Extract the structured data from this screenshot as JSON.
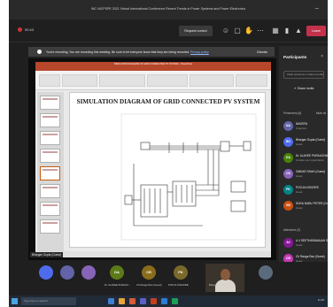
{
  "window": {
    "title": "INC NICPSPE 2021 Virtual International Conference Recent Trends in Power Systems and Power Electronics",
    "minimize_glyph": "−"
  },
  "toolbar": {
    "timer": "00:43",
    "request_control": "Request control",
    "leave": "Leave",
    "icons": [
      "people-icon",
      "chat-icon",
      "hand-icon",
      "more-icon",
      "camera-icon",
      "mic-icon",
      "share-icon"
    ]
  },
  "banner": {
    "message": "You're recording. You are recording this meeting. Be sure to let everyone know that they are being recorded.",
    "link": "Privacy policy",
    "dismiss": "Dismiss"
  },
  "presentation": {
    "app_title": "SIMULATION DIAGRAM OF GRID CONNECTED PV SYSTEM - PowerPoint",
    "slide_title": "SIMULATION DIAGRAM OF GRID CONNECTED PV SYSTEM",
    "presenter": "Bhargav Gupta (Guest)"
  },
  "participants": {
    "header": "Participants",
    "invite_placeholder": "Invite someone or dial a number",
    "share_invite": "Share invite",
    "presenters_section": "Presenters (8)",
    "mute_all": "Mute all",
    "presenters": [
      {
        "initials": "NA",
        "name": "NAVEEN",
        "role": "Organizer",
        "color": "#6264a7"
      },
      {
        "initials": "BG",
        "name": "Bhargav Gupta (Guest)",
        "role": "Guest",
        "color": "#4f6bed"
      },
      {
        "initials": "DA",
        "name": "Dr. ALAVEE PURAACHANDR...",
        "role": "Outside your organization",
        "color": "#498205"
      },
      {
        "initials": "OS",
        "name": "OMKAR SHAH (Guest)",
        "role": "Guest",
        "color": "#8764b8"
      },
      {
        "initials": "PK",
        "name": "POOJA KISHORE",
        "role": "Guest",
        "color": "#038387"
      },
      {
        "initials": "SB",
        "name": "SUNIL BABU PETER (Guest)",
        "role": "Guest",
        "color": "#ca5010"
      }
    ],
    "attendees_section": "Attendees (3)",
    "attendees": [
      {
        "initials": "AV",
        "name": "A V SEETHARAMAIAH S.(...",
        "role": "Guest",
        "color": "#881798"
      },
      {
        "initials": "CR",
        "name": "Ch Ranga Rao (Guest)",
        "role": "Guest",
        "color": "#c239b3"
      },
      {
        "initials": "KG",
        "name": "Kumar (Guest)",
        "role": "Guest",
        "color": "#0078d4"
      }
    ]
  },
  "strip": {
    "tiles": [
      {
        "initials": "",
        "name": "",
        "color": "#4f6bed"
      },
      {
        "initials": "",
        "name": "",
        "color": "#6264a7"
      },
      {
        "initials": "",
        "name": "",
        "color": "#8764b8"
      },
      {
        "initials": "DA",
        "name": "Dr. ALAVEE PURAAC...",
        "color": "#5c7a18"
      },
      {
        "initials": "CR",
        "name": "Ch Ranga Rao (Guest)",
        "color": "#8a6d1c"
      },
      {
        "initials": "PK",
        "name": "POOJA KISHORE",
        "color": "#7a6a2a"
      }
    ],
    "video_name": "Bhargav Gupta",
    "extra_initials": ""
  },
  "taskbar": {
    "search": "Type here to search",
    "clock": "11:45"
  }
}
